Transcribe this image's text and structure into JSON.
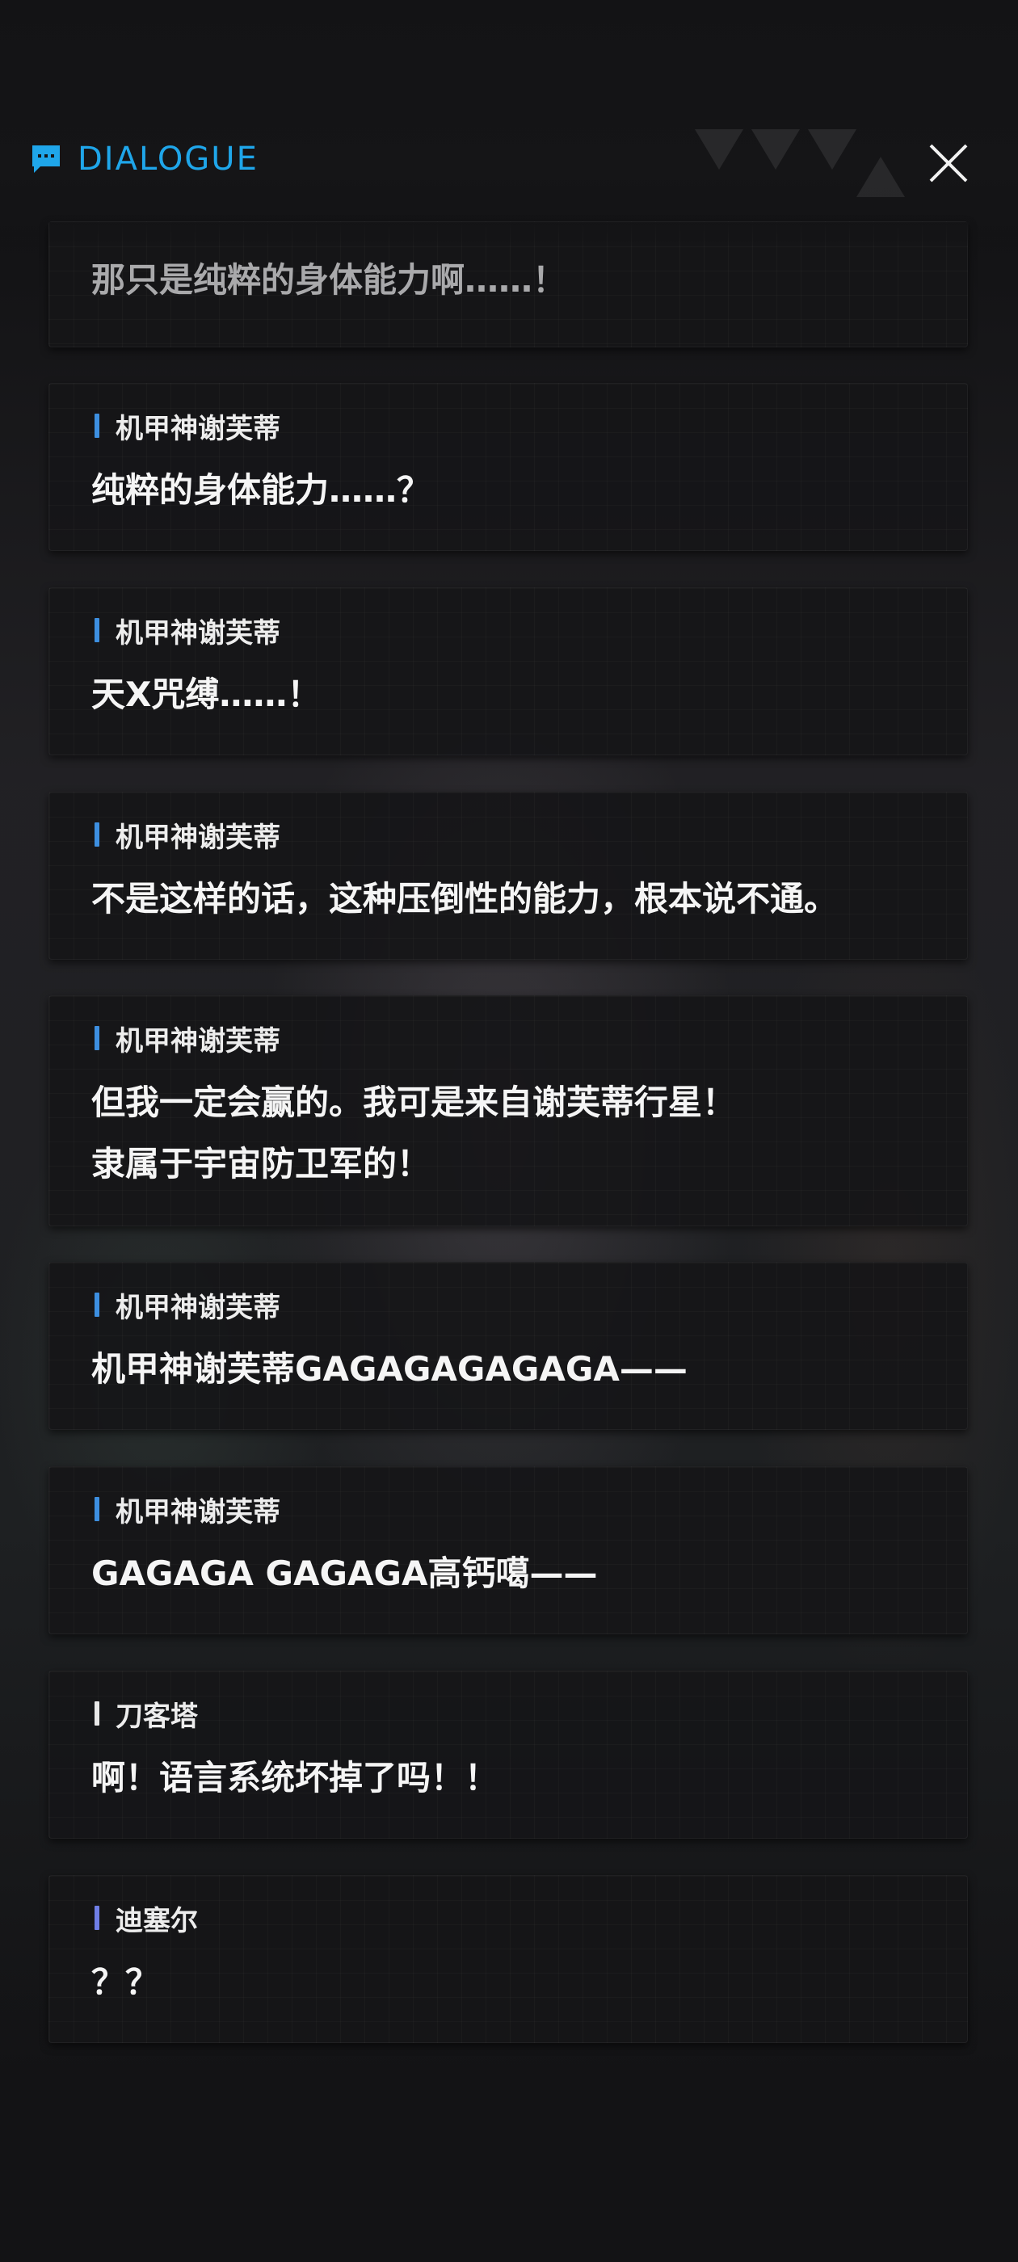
{
  "header": {
    "title": "DIALOGUE",
    "icon": "chat-bubble-icon",
    "accent_color": "#1fa6ea",
    "close_icon": "close-icon"
  },
  "dialogue": [
    {
      "speaker": "",
      "text": "那只是纯粹的身体能力啊……！",
      "bar_color": "#3d8fe0"
    },
    {
      "speaker": "机甲神谢芙蒂",
      "text": "纯粹的身体能力……？",
      "bar_color": "#3d8fe0"
    },
    {
      "speaker": "机甲神谢芙蒂",
      "text": "天X咒缚……！",
      "bar_color": "#3d8fe0"
    },
    {
      "speaker": "机甲神谢芙蒂",
      "text": "不是这样的话，这种压倒性的能力，根本说不通。",
      "bar_color": "#3d8fe0"
    },
    {
      "speaker": "机甲神谢芙蒂",
      "text": "但我一定会赢的。我可是来自谢芙蒂行星！\n隶属于宇宙防卫军的！",
      "bar_color": "#3d8fe0"
    },
    {
      "speaker": "机甲神谢芙蒂",
      "text": "机甲神谢芙蒂GAGAGAGAGAGA——",
      "bar_color": "#3d8fe0"
    },
    {
      "speaker": "机甲神谢芙蒂",
      "text": "GAGAGA GAGAGA高钙噶——",
      "bar_color": "#3d8fe0"
    },
    {
      "speaker": "刀客塔",
      "text": "啊！语言系统坏掉了吗！！",
      "bar_color": "#e8e8e8"
    },
    {
      "speaker": "迪塞尔",
      "text": "？？",
      "bar_color": "#6f7ee6"
    }
  ]
}
